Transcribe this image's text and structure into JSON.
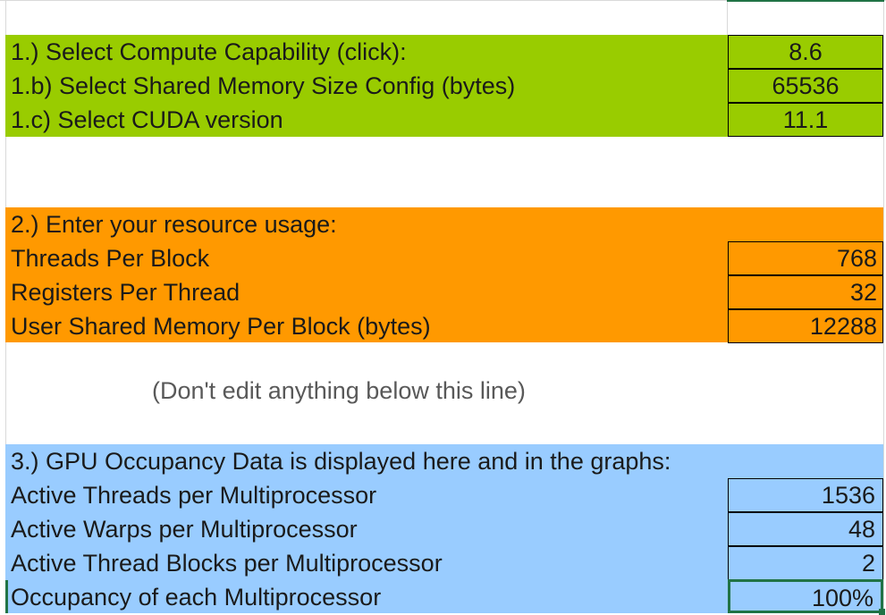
{
  "section1": {
    "rows": [
      {
        "label": "1.) Select Compute Capability (click):",
        "value": "8.6"
      },
      {
        "label": "1.b) Select Shared Memory Size Config (bytes)",
        "value": "65536"
      },
      {
        "label": "1.c) Select CUDA version",
        "value": "11.1"
      }
    ],
    "color": "#99cc00"
  },
  "section2": {
    "heading": "2.) Enter your resource usage:",
    "rows": [
      {
        "label": "Threads Per Block",
        "value": "768"
      },
      {
        "label": "Registers Per Thread",
        "value": "32"
      },
      {
        "label": "User Shared Memory Per Block (bytes)",
        "value": "12288"
      }
    ],
    "color": "#ff9900"
  },
  "note": "(Don't edit anything below this line)",
  "section3": {
    "heading": "3.) GPU Occupancy Data is displayed here and in the graphs:",
    "rows": [
      {
        "label": "Active Threads per Multiprocessor",
        "value": "1536"
      },
      {
        "label": "Active Warps per Multiprocessor",
        "value": "48"
      },
      {
        "label": "Active Thread Blocks per Multiprocessor",
        "value": "2"
      },
      {
        "label": "Occupancy of each Multiprocessor",
        "value": "100%"
      }
    ],
    "color": "#99ccff"
  },
  "selection_color": "#217346"
}
